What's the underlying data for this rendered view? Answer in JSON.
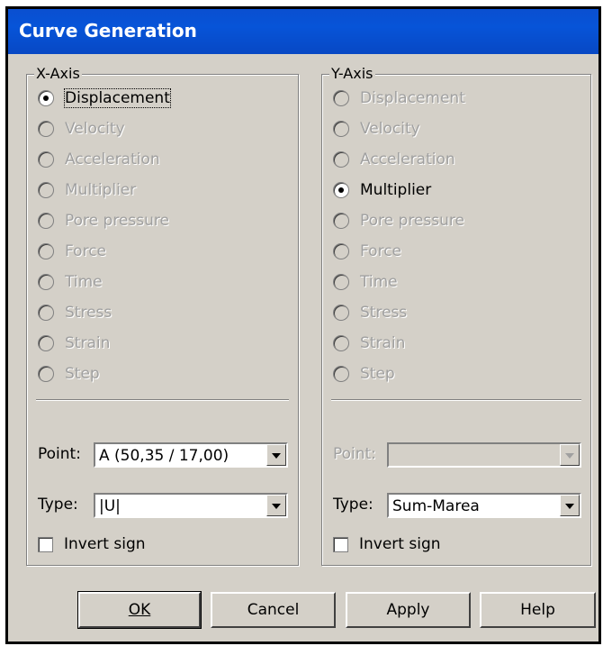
{
  "window": {
    "title": "Curve Generation"
  },
  "x_axis": {
    "legend": "X-Axis",
    "options": [
      {
        "label": "Displacement",
        "checked": true,
        "enabled": true
      },
      {
        "label": "Velocity",
        "checked": false,
        "enabled": false
      },
      {
        "label": "Acceleration",
        "checked": false,
        "enabled": false
      },
      {
        "label": "Multiplier",
        "checked": false,
        "enabled": false
      },
      {
        "label": "Pore pressure",
        "checked": false,
        "enabled": false
      },
      {
        "label": "Force",
        "checked": false,
        "enabled": false
      },
      {
        "label": "Time",
        "checked": false,
        "enabled": false
      },
      {
        "label": "Stress",
        "checked": false,
        "enabled": false
      },
      {
        "label": "Strain",
        "checked": false,
        "enabled": false
      },
      {
        "label": "Step",
        "checked": false,
        "enabled": false
      }
    ],
    "point_label": "Point:",
    "point_value": "A (50,35 / 17,00)",
    "type_label": "Type:",
    "type_value": "|U|",
    "invert_label": "Invert sign"
  },
  "y_axis": {
    "legend": "Y-Axis",
    "options": [
      {
        "label": "Displacement",
        "checked": false,
        "enabled": false
      },
      {
        "label": "Velocity",
        "checked": false,
        "enabled": false
      },
      {
        "label": "Acceleration",
        "checked": false,
        "enabled": false
      },
      {
        "label": "Multiplier",
        "checked": true,
        "enabled": true
      },
      {
        "label": "Pore pressure",
        "checked": false,
        "enabled": false
      },
      {
        "label": "Force",
        "checked": false,
        "enabled": false
      },
      {
        "label": "Time",
        "checked": false,
        "enabled": false
      },
      {
        "label": "Stress",
        "checked": false,
        "enabled": false
      },
      {
        "label": "Strain",
        "checked": false,
        "enabled": false
      },
      {
        "label": "Step",
        "checked": false,
        "enabled": false
      }
    ],
    "point_label": "Point:",
    "point_value": "",
    "type_label": "Type:",
    "type_value": "Sum-Marea",
    "invert_label": "Invert sign"
  },
  "buttons": {
    "ok_label": "OK",
    "cancel_label": "Cancel",
    "apply_label": "Apply",
    "help_label": "Help"
  },
  "colors": {
    "title_bar": "#0a4fd0",
    "dialog_face": "#d4d0c8",
    "disabled_text": "#a0a0a0"
  }
}
